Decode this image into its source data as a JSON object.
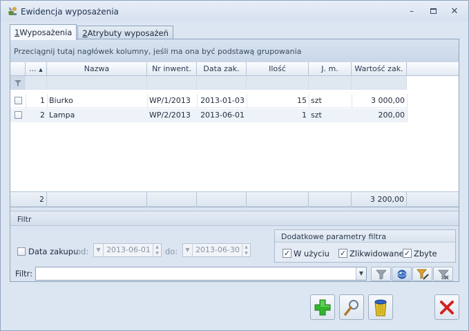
{
  "window": {
    "title": "Ewidencja wyposażenia"
  },
  "tabs": [
    {
      "key": "1",
      "label": " Wyposażenia"
    },
    {
      "key": "2",
      "label": " Atrybuty wyposażeń"
    }
  ],
  "grid": {
    "group_hint": "Przeciągnij tutaj nagłówek kolumny, jeśli ma ona być podstawą grupowania",
    "columns": [
      "...",
      "Nazwa",
      "Nr inwent.",
      "Data zak.",
      "Ilość",
      "J. m.",
      "Wartość zak."
    ],
    "rows": [
      {
        "lp": "1",
        "nazwa": "Biurko",
        "nr": "WP/1/2013",
        "data": "2013-01-03",
        "ilosc": "15",
        "jm": "szt",
        "wartosc": "3 000,00"
      },
      {
        "lp": "2",
        "nazwa": "Lampa",
        "nr": "WP/2/2013",
        "data": "2013-06-01",
        "ilosc": "1",
        "jm": "szt",
        "wartosc": "200,00"
      }
    ],
    "footer": {
      "count": "2",
      "total": "3 200,00"
    }
  },
  "filter": {
    "title": "Filtr",
    "date_label": "Data zakupu",
    "from_label": "od:",
    "from_value": "2013-06-01",
    "to_label": "do:",
    "to_value": "2013-06-30",
    "params_title": "Dodatkowe parametry filtra",
    "params": [
      {
        "label": "W użyciu",
        "checked": true
      },
      {
        "label": "Zlikwidowane",
        "checked": true
      },
      {
        "label": "Zbyte",
        "checked": true
      }
    ],
    "filter_label": "Filtr:",
    "filter_value": ""
  },
  "icons": {
    "add": "plus-icon",
    "view": "magnifier-icon",
    "delete": "trash-icon",
    "close": "red-x-icon"
  }
}
